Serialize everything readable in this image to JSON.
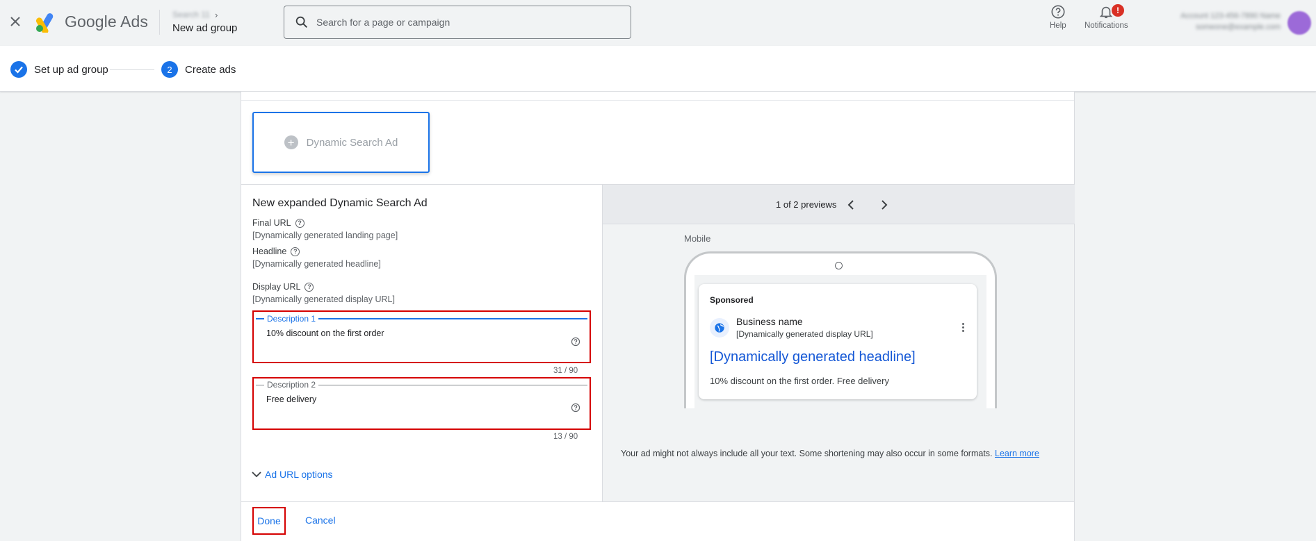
{
  "header": {
    "brand_google": "Google",
    "brand_ads": "Ads",
    "account_crumb": "Search 11",
    "page_title": "New ad group",
    "search_placeholder": "Search for a page or campaign",
    "help_label": "Help",
    "notifications_label": "Notifications",
    "notifications_badge": "!",
    "account_line1": "Account 123-456-7890 Name",
    "account_line2": "someone@example.com"
  },
  "stepper": {
    "steps": [
      {
        "label": "Set up ad group",
        "state": "done"
      },
      {
        "number": "2",
        "label": "Create ads",
        "state": "current"
      }
    ]
  },
  "ad_type_tile": {
    "label": "Dynamic Search Ad",
    "plus": "+"
  },
  "form": {
    "title": "New expanded Dynamic Search Ad",
    "final_url": {
      "label": "Final URL",
      "value": "[Dynamically generated landing page]"
    },
    "headline": {
      "label": "Headline",
      "value": "[Dynamically generated headline]"
    },
    "display_url": {
      "label": "Display URL",
      "value": "[Dynamically generated display URL]"
    },
    "description_1": {
      "label": "Description 1",
      "value": "10% discount on the first order",
      "counter": "31 / 90"
    },
    "description_2": {
      "label": "Description 2",
      "value": "Free delivery",
      "counter": "13 / 90"
    },
    "url_options_label": "Ad URL options",
    "help_glyph": "?"
  },
  "preview": {
    "count_text": "1 of 2 previews",
    "device_label": "Mobile",
    "ad": {
      "sponsored": "Sponsored",
      "business_name": "Business name",
      "display_url": "[Dynamically generated display URL]",
      "headline": "[Dynamically generated headline]",
      "description": "10% discount on the first order. Free delivery"
    },
    "note": "Your ad might not always include all your text. Some shortening may also occur in some formats.",
    "learn_more": "Learn more"
  },
  "footer": {
    "done_label": "Done",
    "cancel_label": "Cancel"
  },
  "colors": {
    "accent": "#1a73e8",
    "highlight_red": "#d50000",
    "badge_red": "#d93025"
  }
}
